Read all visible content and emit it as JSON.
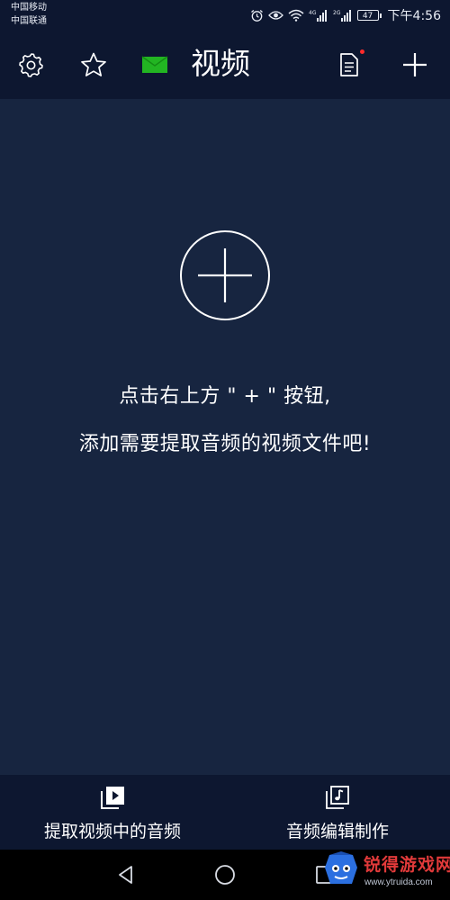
{
  "status_bar": {
    "carrier_1": "中国移动",
    "carrier_2": "中国联通",
    "network_1": "4G",
    "network_2": "2G",
    "battery": "47",
    "time": "下午4:56",
    "icons": [
      "alarm-icon",
      "eye-icon",
      "wifi-icon",
      "signal-icon",
      "battery-icon"
    ]
  },
  "header": {
    "title": "视频",
    "icons": [
      "gear-icon",
      "star-icon",
      "envelope-icon",
      "document-icon",
      "plus-icon"
    ],
    "document_badge_color": "#ff2b2b",
    "envelope_color": "#22b522"
  },
  "main": {
    "add_icon": "circle-plus-icon",
    "hint_line_1": "点击右上方 \" + \" 按钮,",
    "hint_line_2": "添加需要提取音频的视频文件吧!"
  },
  "bottom_nav": {
    "items": [
      {
        "label": "提取视频中的音频",
        "icon": "video-play-icon"
      },
      {
        "label": "音频编辑制作",
        "icon": "music-note-icon"
      }
    ]
  },
  "system_nav": {
    "buttons": [
      "back-icon",
      "home-icon",
      "recents-icon"
    ]
  },
  "watermark": {
    "title": "锐得游戏网",
    "url": "www.ytruida.com"
  },
  "colors": {
    "background": "#172540",
    "bars": "#0d1730",
    "accent_badge": "#ff2b2b"
  }
}
